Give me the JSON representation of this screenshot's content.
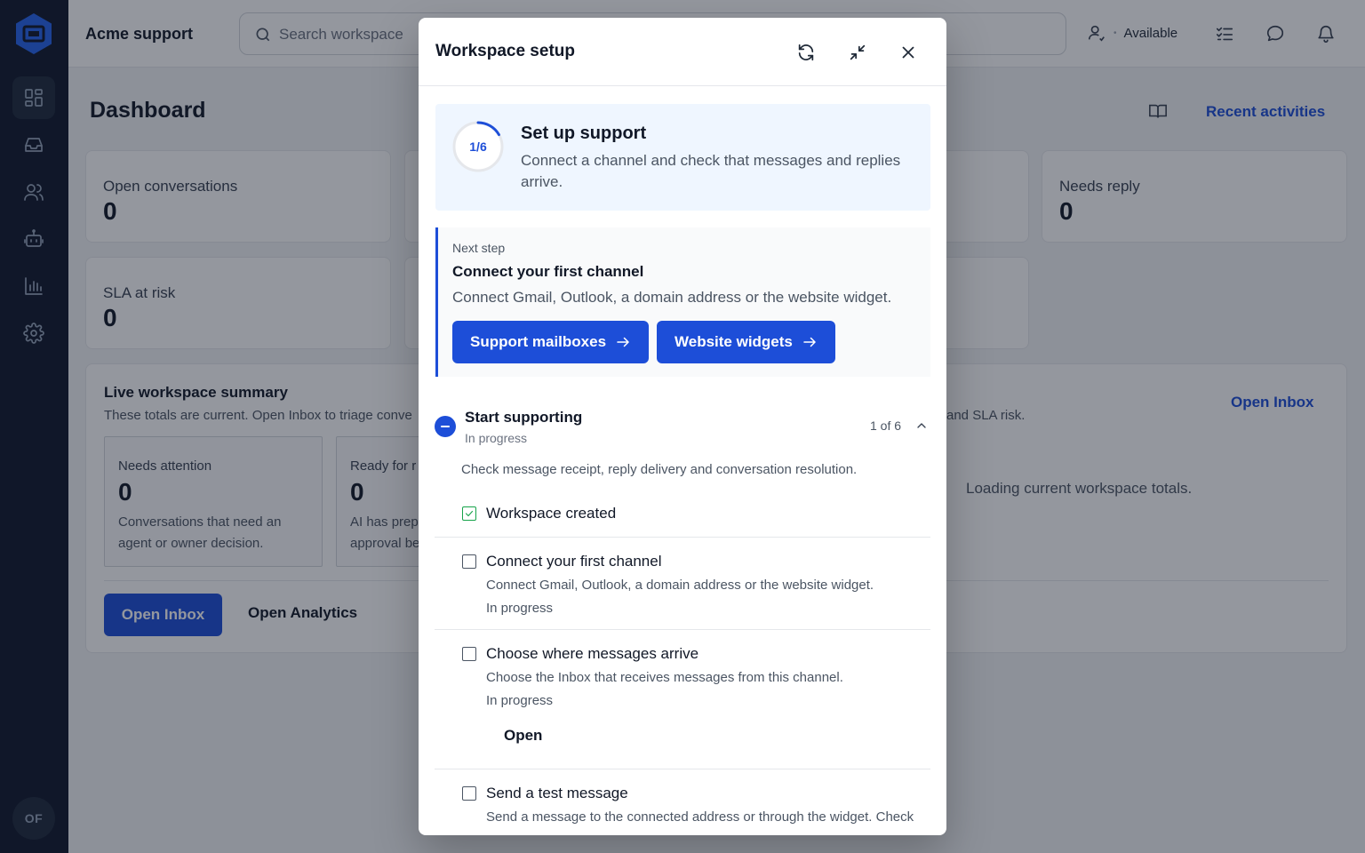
{
  "app": {
    "title": "Acme support",
    "user_initials": "OF"
  },
  "search": {
    "placeholder": "Search workspace"
  },
  "topbar": {
    "presence_label": "Available",
    "icons": [
      "user-icon",
      "checklist-icon",
      "chat-bubble-icon",
      "bell-icon"
    ]
  },
  "sidebar": {
    "items": [
      {
        "icon": "dashboard-icon",
        "active": true
      },
      {
        "icon": "inbox-icon",
        "active": false
      },
      {
        "icon": "users-icon",
        "active": false
      },
      {
        "icon": "bot-icon",
        "active": false
      },
      {
        "icon": "analytics-icon",
        "active": false
      },
      {
        "icon": "settings-icon",
        "active": false
      }
    ]
  },
  "dashboard": {
    "title": "Dashboard",
    "recent_activities": "Recent activities",
    "cards": [
      {
        "label": "Open conversations",
        "value": "0"
      },
      {
        "label": "Needs reply",
        "value": "0"
      },
      {
        "label": "SLA at risk",
        "value": "0"
      }
    ],
    "summary": {
      "title": "Live workspace summary",
      "description": "These totals are current. Open Inbox to triage conve",
      "description_right": "and SLA risk.",
      "open_inbox_link": "Open Inbox",
      "loading_text": "Loading current workspace totals.",
      "tiles": [
        {
          "label": "Needs attention",
          "value": "0",
          "desc": "Conversations that need an agent or owner decision."
        },
        {
          "label": "Ready for r",
          "value": "0",
          "desc": "AI has prep approval be"
        }
      ],
      "primary_button": "Open Inbox",
      "secondary_button": "Open Analytics"
    }
  },
  "modal": {
    "title": "Workspace setup",
    "progress": {
      "label": "1/6",
      "fraction": 0.1667,
      "title": "Set up support",
      "description": "Connect a channel and check that messages and replies arrive."
    },
    "next_step": {
      "eyebrow": "Next step",
      "title": "Connect your first channel",
      "description": "Connect Gmail, Outlook, a domain address or the website widget.",
      "buttons": [
        "Support mailboxes",
        "Website widgets"
      ]
    },
    "group": {
      "title": "Start supporting",
      "status": "In progress",
      "count": "1 of 6",
      "description": "Check message receipt, reply delivery and conversation resolution."
    },
    "tasks": [
      {
        "title": "Workspace created",
        "done": true
      },
      {
        "title": "Connect your first channel",
        "desc": "Connect Gmail, Outlook, a domain address or the website widget.",
        "status": "In progress",
        "done": false
      },
      {
        "title": "Choose where messages arrive",
        "desc": "Choose the Inbox that receives messages from this channel.",
        "status": "In progress",
        "action": "Open",
        "done": false
      },
      {
        "title": "Send a test message",
        "desc": "Send a message to the connected address or through the widget. Check",
        "done": false
      }
    ]
  }
}
